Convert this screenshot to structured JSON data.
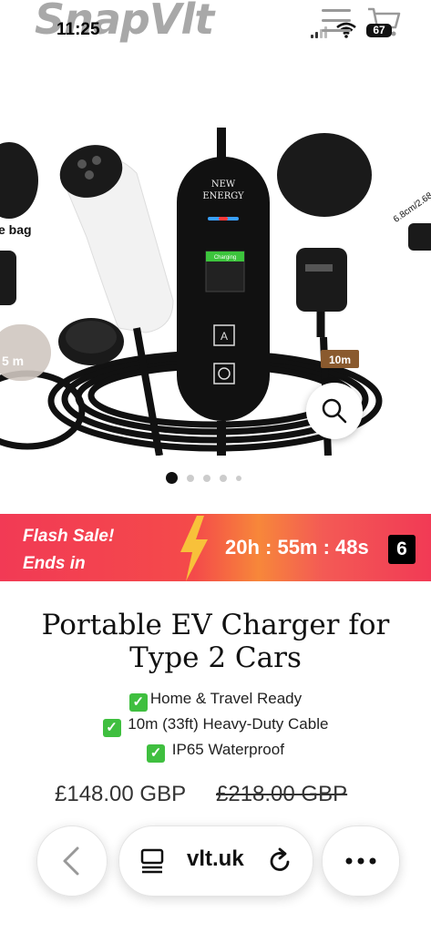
{
  "status_bar": {
    "time": "11:25",
    "battery": "67"
  },
  "header": {
    "logo": "SnapVlt"
  },
  "gallery": {
    "left_bag_text": "e bag",
    "left_length_badge": "5 m",
    "center_device_label_line1": "NEW",
    "center_device_label_line2": "ENERGY",
    "screen_status": "Charging",
    "button_a_label": "A",
    "length_badge": "10m",
    "right_edge_text": "6.8cm/2.68",
    "slide_count": 5,
    "active_slide": 1
  },
  "flash_sale": {
    "line1": "Flash Sale!",
    "line2": "Ends in",
    "countdown": "20h : 55m : 48s",
    "countdown_badge": "6"
  },
  "product": {
    "title_line1": "Portable EV Charger for",
    "title_line2": "Type 2 Cars",
    "features": [
      "Home & Travel Ready",
      "10m (33ft) Heavy-Duty Cable",
      "IP65 Waterproof"
    ],
    "price": "£148.00 GBP",
    "compare_price": "£218.00 GBP"
  },
  "browser": {
    "url": "vlt.uk"
  },
  "colors": {
    "flash_red": "#f23a55",
    "flash_orange": "#f7873a",
    "check_green": "#3fbf3f"
  },
  "icons": [
    "menu-icon",
    "cart-icon",
    "signal-icon",
    "wifi-icon",
    "battery-icon",
    "search-icon",
    "lightning-icon",
    "check-icon",
    "chevron-left-icon",
    "tabs-icon",
    "reload-icon",
    "more-icon"
  ]
}
